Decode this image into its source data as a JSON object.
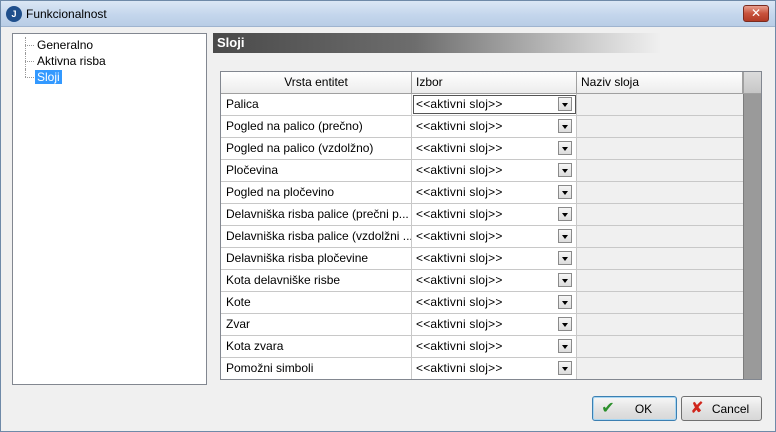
{
  "window": {
    "title": "Funkcionalnost",
    "icon": "app-logo-icon",
    "close_symbol": "✕"
  },
  "tree": {
    "items": [
      {
        "label": "Generalno",
        "selected": false
      },
      {
        "label": "Aktivna risba",
        "selected": false
      },
      {
        "label": "Sloji",
        "selected": true
      }
    ]
  },
  "section": {
    "title": "Sloji"
  },
  "grid": {
    "columns": [
      "Vrsta entitet",
      "Izbor",
      "Naziv sloja"
    ],
    "rows": [
      {
        "type": "Palica",
        "choice": "<<aktivni sloj>>",
        "layer": ""
      },
      {
        "type": "Pogled na palico (prečno)",
        "choice": "<<aktivni sloj>>",
        "layer": ""
      },
      {
        "type": "Pogled na palico (vzdolžno)",
        "choice": "<<aktivni sloj>>",
        "layer": ""
      },
      {
        "type": "Pločevina",
        "choice": "<<aktivni sloj>>",
        "layer": ""
      },
      {
        "type": "Pogled na pločevino",
        "choice": "<<aktivni sloj>>",
        "layer": ""
      },
      {
        "type": "Delavniška risba palice (prečni p...",
        "choice": "<<aktivni sloj>>",
        "layer": ""
      },
      {
        "type": "Delavniška risba palice (vzdolžni ...",
        "choice": "<<aktivni sloj>>",
        "layer": ""
      },
      {
        "type": "Delavniška risba pločevine",
        "choice": "<<aktivni sloj>>",
        "layer": ""
      },
      {
        "type": "Kota delavniške risbe",
        "choice": "<<aktivni sloj>>",
        "layer": ""
      },
      {
        "type": "Kote",
        "choice": "<<aktivni sloj>>",
        "layer": ""
      },
      {
        "type": "Zvar",
        "choice": "<<aktivni sloj>>",
        "layer": ""
      },
      {
        "type": "Kota zvara",
        "choice": "<<aktivni sloj>>",
        "layer": ""
      },
      {
        "type": "Pomožni simboli",
        "choice": "<<aktivni sloj>>",
        "layer": ""
      }
    ]
  },
  "buttons": {
    "ok": {
      "label": "OK",
      "icon": "checkmark-icon",
      "symbol": "✔"
    },
    "cancel": {
      "label": "Cancel",
      "icon": "cross-icon",
      "symbol": "✘"
    }
  },
  "colors": {
    "selection": "#3399ff",
    "header_band": "#4a4a4a",
    "ok_icon": "#2b8f2b",
    "cancel_icon": "#d0261c"
  }
}
